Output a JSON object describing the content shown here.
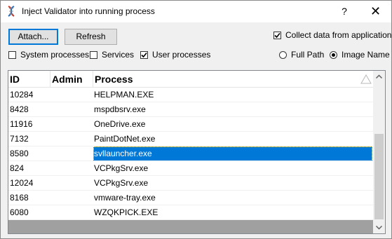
{
  "window": {
    "title": "Inject Validator into running process",
    "help_label": "?",
    "close_label": "✕"
  },
  "toolbar": {
    "attach_label": "Attach...",
    "refresh_label": "Refresh",
    "collect_label": "Collect data from application",
    "collect_checked": true
  },
  "filters": {
    "system_label": "System processes",
    "system_checked": false,
    "services_label": "Services",
    "services_checked": false,
    "user_label": "User processes",
    "user_checked": true
  },
  "display_mode": {
    "full_path_label": "Full Path",
    "image_name_label": "Image Name",
    "selected": "Image Name"
  },
  "table": {
    "columns": [
      "ID",
      "Admin",
      "Process"
    ],
    "rows": [
      {
        "id": "10284",
        "admin": "",
        "process": "HELPMAN.EXE"
      },
      {
        "id": "8428",
        "admin": "",
        "process": "mspdbsrv.exe"
      },
      {
        "id": "11916",
        "admin": "",
        "process": "OneDrive.exe"
      },
      {
        "id": "7132",
        "admin": "",
        "process": "PaintDotNet.exe"
      },
      {
        "id": "8580",
        "admin": "",
        "process": "svllauncher.exe"
      },
      {
        "id": "824",
        "admin": "",
        "process": "VCPkgSrv.exe"
      },
      {
        "id": "12024",
        "admin": "",
        "process": "VCPkgSrv.exe"
      },
      {
        "id": "8168",
        "admin": "",
        "process": "vmware-tray.exe"
      },
      {
        "id": "6080",
        "admin": "",
        "process": "WZQKPICK.EXE"
      }
    ],
    "selected_index": 4
  },
  "icons": {
    "app": "dna-icon",
    "sort": "sort-triangle-icon",
    "check": "checkmark-icon"
  },
  "colors": {
    "selection": "#0078d7",
    "list_empty_area": "#a0a0a0"
  }
}
